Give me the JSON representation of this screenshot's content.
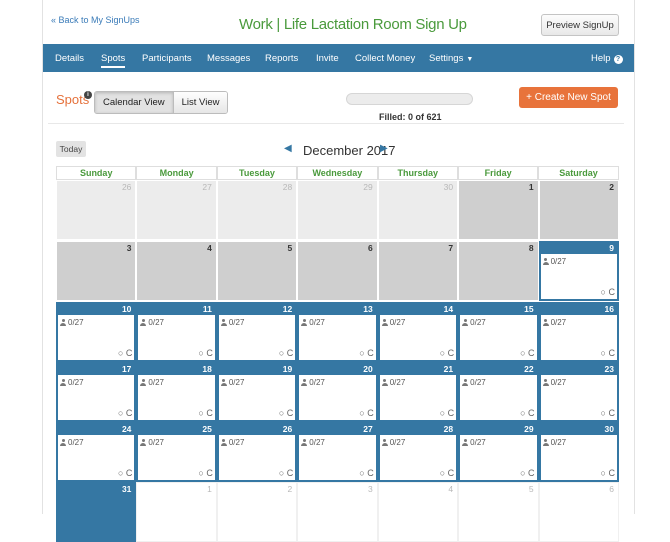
{
  "header": {
    "back_link": "« Back to My SignUps",
    "title": "Work | Life Lactation Room Sign Up",
    "preview_button": "Preview SignUp"
  },
  "nav": {
    "items": [
      {
        "label": "Details"
      },
      {
        "label": "Spots",
        "active": true
      },
      {
        "label": "Participants"
      },
      {
        "label": "Messages"
      },
      {
        "label": "Reports"
      },
      {
        "label": "Invite"
      },
      {
        "label": "Collect Money"
      },
      {
        "label": "Settings"
      }
    ],
    "help": "Help"
  },
  "toolbar": {
    "spots_label": "Spots",
    "info_icon": "i",
    "calendar_view": "Calendar View",
    "list_view": "List View",
    "filled_text": "Filled: 0 of 621",
    "filled_fraction": 0.0,
    "create_button": "+ Create New Spot"
  },
  "calendar": {
    "today_button": "Today",
    "prev_arrow": "◀",
    "month_label": "December 2017",
    "next_arrow": "▶",
    "weekdays": [
      "Sunday",
      "Monday",
      "Tuesday",
      "Wednesday",
      "Thursday",
      "Friday",
      "Saturday"
    ],
    "slot_text": "0/27",
    "cell_icons": "○ C",
    "weeks": [
      [
        {
          "day": "26",
          "state": "past"
        },
        {
          "day": "27",
          "state": "past"
        },
        {
          "day": "28",
          "state": "past"
        },
        {
          "day": "29",
          "state": "past"
        },
        {
          "day": "30",
          "state": "past"
        },
        {
          "day": "1",
          "state": "darkpast"
        },
        {
          "day": "2",
          "state": "darkpast"
        }
      ],
      [
        {
          "day": "3",
          "state": "darkpast"
        },
        {
          "day": "4",
          "state": "darkpast"
        },
        {
          "day": "5",
          "state": "darkpast"
        },
        {
          "day": "6",
          "state": "darkpast"
        },
        {
          "day": "7",
          "state": "darkpast"
        },
        {
          "day": "8",
          "state": "darkpast"
        },
        {
          "day": "9",
          "state": "active"
        }
      ],
      [
        {
          "day": "10",
          "state": "active"
        },
        {
          "day": "11",
          "state": "active"
        },
        {
          "day": "12",
          "state": "active"
        },
        {
          "day": "13",
          "state": "active"
        },
        {
          "day": "14",
          "state": "active"
        },
        {
          "day": "15",
          "state": "active"
        },
        {
          "day": "16",
          "state": "active"
        }
      ],
      [
        {
          "day": "17",
          "state": "active"
        },
        {
          "day": "18",
          "state": "active"
        },
        {
          "day": "19",
          "state": "active"
        },
        {
          "day": "20",
          "state": "active"
        },
        {
          "day": "21",
          "state": "active"
        },
        {
          "day": "22",
          "state": "active"
        },
        {
          "day": "23",
          "state": "active"
        }
      ],
      [
        {
          "day": "24",
          "state": "active"
        },
        {
          "day": "25",
          "state": "active"
        },
        {
          "day": "26",
          "state": "active"
        },
        {
          "day": "27",
          "state": "active"
        },
        {
          "day": "28",
          "state": "active"
        },
        {
          "day": "29",
          "state": "active"
        },
        {
          "day": "30",
          "state": "active"
        }
      ],
      [
        {
          "day": "31",
          "state": "active"
        },
        {
          "day": "1",
          "state": "future"
        },
        {
          "day": "2",
          "state": "future"
        },
        {
          "day": "3",
          "state": "future"
        },
        {
          "day": "4",
          "state": "future"
        },
        {
          "day": "5",
          "state": "future"
        },
        {
          "day": "6",
          "state": "future"
        }
      ]
    ]
  },
  "colors": {
    "brand_blue": "#3577a3",
    "accent_orange": "#e8733b",
    "title_green": "#4a9a3c"
  }
}
